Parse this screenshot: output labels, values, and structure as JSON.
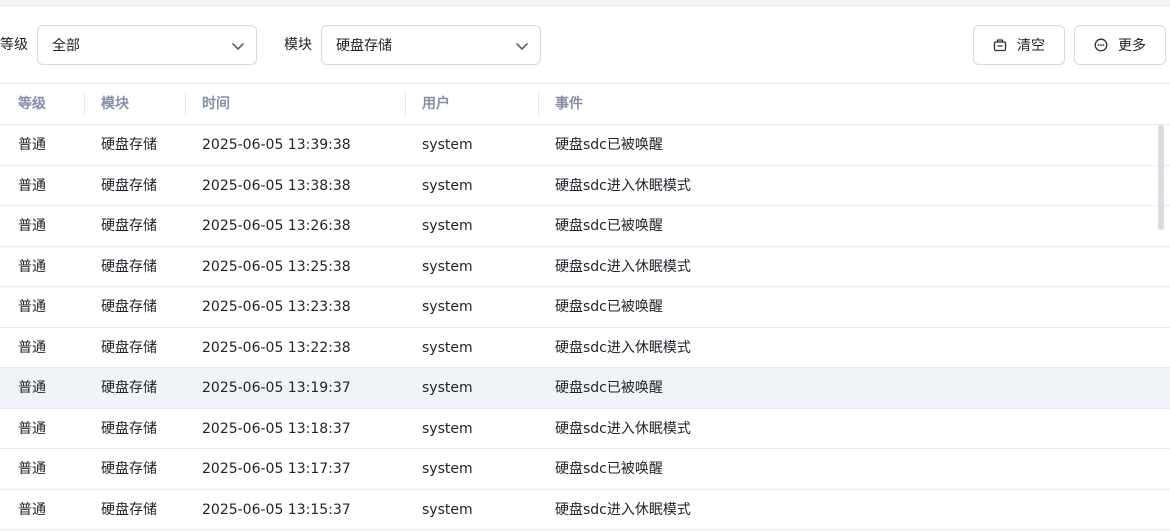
{
  "filters": {
    "level_label": "等级",
    "level_value": "全部",
    "module_label": "模块",
    "module_value": "硬盘存储"
  },
  "actions": {
    "clear_label": "清空",
    "more_label": "更多"
  },
  "table": {
    "columns": [
      "等级",
      "模块",
      "时间",
      "用户",
      "事件"
    ],
    "rows": [
      {
        "level": "普通",
        "module": "硬盘存储",
        "time": "2025-06-05 13:39:38",
        "user": "system",
        "event": "硬盘sdc已被唤醒"
      },
      {
        "level": "普通",
        "module": "硬盘存储",
        "time": "2025-06-05 13:38:38",
        "user": "system",
        "event": "硬盘sdc进入休眠模式"
      },
      {
        "level": "普通",
        "module": "硬盘存储",
        "time": "2025-06-05 13:26:38",
        "user": "system",
        "event": "硬盘sdc已被唤醒"
      },
      {
        "level": "普通",
        "module": "硬盘存储",
        "time": "2025-06-05 13:25:38",
        "user": "system",
        "event": "硬盘sdc进入休眠模式"
      },
      {
        "level": "普通",
        "module": "硬盘存储",
        "time": "2025-06-05 13:23:38",
        "user": "system",
        "event": "硬盘sdc已被唤醒"
      },
      {
        "level": "普通",
        "module": "硬盘存储",
        "time": "2025-06-05 13:22:38",
        "user": "system",
        "event": "硬盘sdc进入休眠模式"
      },
      {
        "level": "普通",
        "module": "硬盘存储",
        "time": "2025-06-05 13:19:37",
        "user": "system",
        "event": "硬盘sdc已被唤醒"
      },
      {
        "level": "普通",
        "module": "硬盘存储",
        "time": "2025-06-05 13:18:37",
        "user": "system",
        "event": "硬盘sdc进入休眠模式"
      },
      {
        "level": "普通",
        "module": "硬盘存储",
        "time": "2025-06-05 13:17:37",
        "user": "system",
        "event": "硬盘sdc已被唤醒"
      },
      {
        "level": "普通",
        "module": "硬盘存储",
        "time": "2025-06-05 13:15:37",
        "user": "system",
        "event": "硬盘sdc进入休眠模式"
      }
    ],
    "highlighted_row": 6
  },
  "icons": {
    "clear": "clear-icon",
    "more": "more-icon",
    "dropdown": "chevron-down-icon"
  },
  "colors": {
    "header_text": "#8590a6",
    "border": "#d5d9e0",
    "row_highlight": "#f0f3f8"
  }
}
